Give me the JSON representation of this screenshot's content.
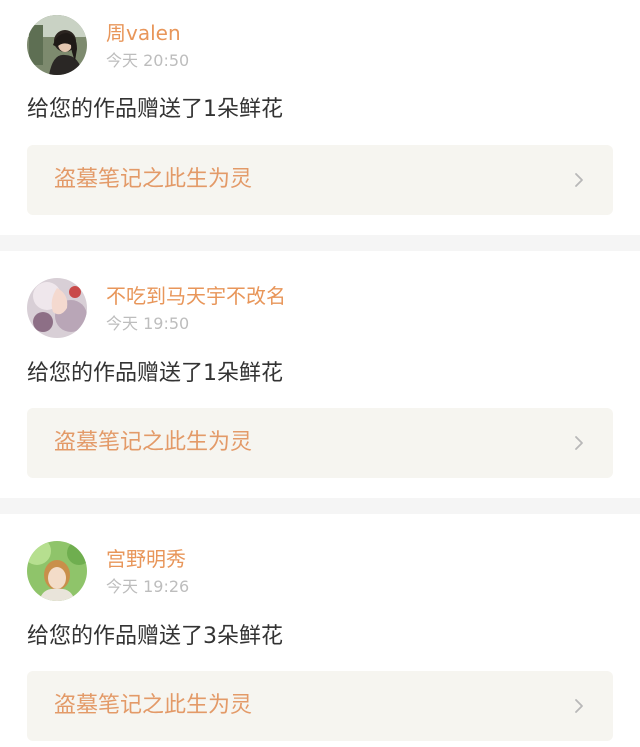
{
  "notifications": [
    {
      "username": "周valen",
      "time": "今天 20:50",
      "message": "给您的作品赠送了1朵鲜花",
      "work_title": "盗墓笔记之此生为灵",
      "avatar_icon": "user-avatar-icon"
    },
    {
      "username": "不吃到马天宇不改名",
      "time": "今天 19:50",
      "message": "给您的作品赠送了1朵鲜花",
      "work_title": "盗墓笔记之此生为灵",
      "avatar_icon": "user-avatar-icon"
    },
    {
      "username": "宫野明秀",
      "time": "今天 19:26",
      "message": "给您的作品赠送了3朵鲜花",
      "work_title": "盗墓笔记之此生为灵",
      "avatar_icon": "user-avatar-icon"
    }
  ],
  "colors": {
    "username": "#e8965a",
    "time": "#bdbdbd",
    "message": "#333333",
    "work_bg": "#f6f5f0",
    "work_title": "#e39a68",
    "divider": "#f5f5f5"
  }
}
